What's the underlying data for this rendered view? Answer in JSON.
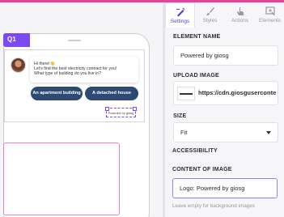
{
  "canvas": {
    "question_badge": "Q1",
    "bot_message": {
      "line1": "Hi there!👋",
      "line2": "Let's find the best electricity contract for you!",
      "line3": "What type of building do you live in?"
    },
    "options": [
      "An apartment building",
      "A detached house"
    ],
    "logo_text": "Powered by giosg"
  },
  "tabs": [
    {
      "label": "Settings",
      "icon": "settings-brush-icon",
      "active": true
    },
    {
      "label": "Styles",
      "icon": "brush-icon",
      "active": false
    },
    {
      "label": "Actions",
      "icon": "pointer-hand-icon",
      "active": false
    },
    {
      "label": "Elements",
      "icon": "add-element-icon",
      "active": false
    }
  ],
  "panel": {
    "element_name_label": "ELEMENT NAME",
    "element_name_value": "Powered by giosg",
    "upload_image_label": "UPLOAD IMAGE",
    "upload_image_url": "https://cdn.giosguserconte",
    "size_label": "SIZE",
    "size_value": "Fit",
    "accessibility_label": "ACCESSIBILITY",
    "content_of_image_label": "CONTENT OF IMAGE",
    "content_of_image_value": "Logo: Powered by giosg",
    "help_text": "Leave empty for background images"
  },
  "colors": {
    "accent": "#7a4bf0",
    "highlight": "#e97fd2",
    "button_bg": "#2c4a73",
    "top_strip": "#e6429b"
  }
}
